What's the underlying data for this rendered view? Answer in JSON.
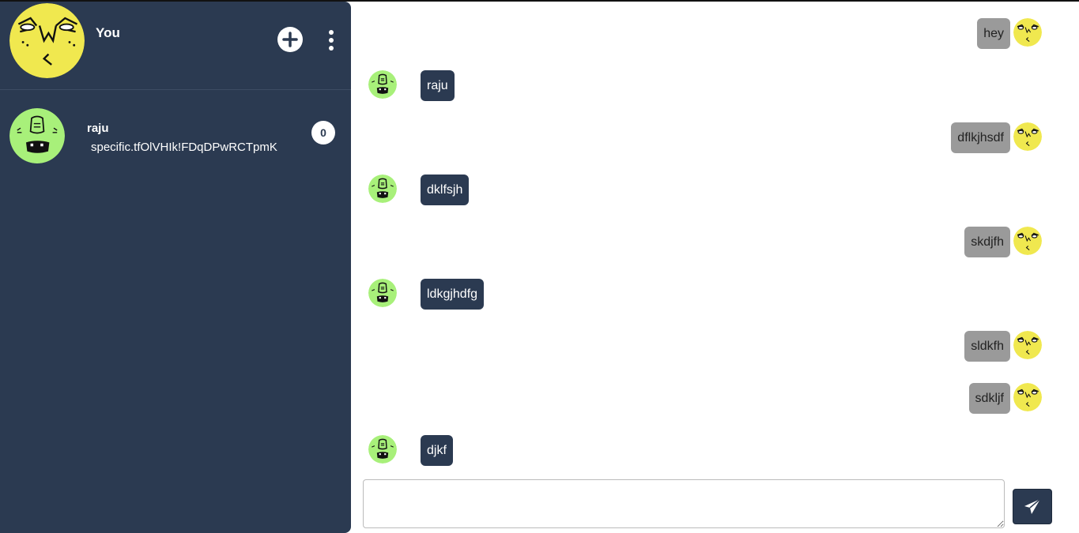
{
  "me": {
    "name": "You",
    "avatar_color": "#f0e84f"
  },
  "header_actions": {
    "new_chat_icon": "plus-icon",
    "menu_icon": "vertical-dots-icon"
  },
  "contacts": [
    {
      "name": "raju",
      "preview": "specific.tfOlVHIk!FDqDPwRCTpmK",
      "unread": "0",
      "avatar_color": "#a8f07a"
    }
  ],
  "messages": [
    {
      "direction": "out",
      "text": "hey"
    },
    {
      "direction": "in",
      "text": "raju"
    },
    {
      "direction": "out",
      "text": "dflkjhsdf"
    },
    {
      "direction": "in",
      "text": "dklfsjh"
    },
    {
      "direction": "out",
      "text": "skdjfh"
    },
    {
      "direction": "in",
      "text": "ldkgjhdfg"
    },
    {
      "direction": "out",
      "text": "sldkfh"
    },
    {
      "direction": "out",
      "text": "sdkljf"
    },
    {
      "direction": "in",
      "text": "djkf"
    }
  ],
  "composer": {
    "placeholder": "",
    "value": "",
    "send_icon": "paper-plane-icon"
  },
  "colors": {
    "sidebar": "#2b3a51",
    "incoming_bubble": "#2b3a51",
    "outgoing_bubble": "#9a9a9a"
  }
}
